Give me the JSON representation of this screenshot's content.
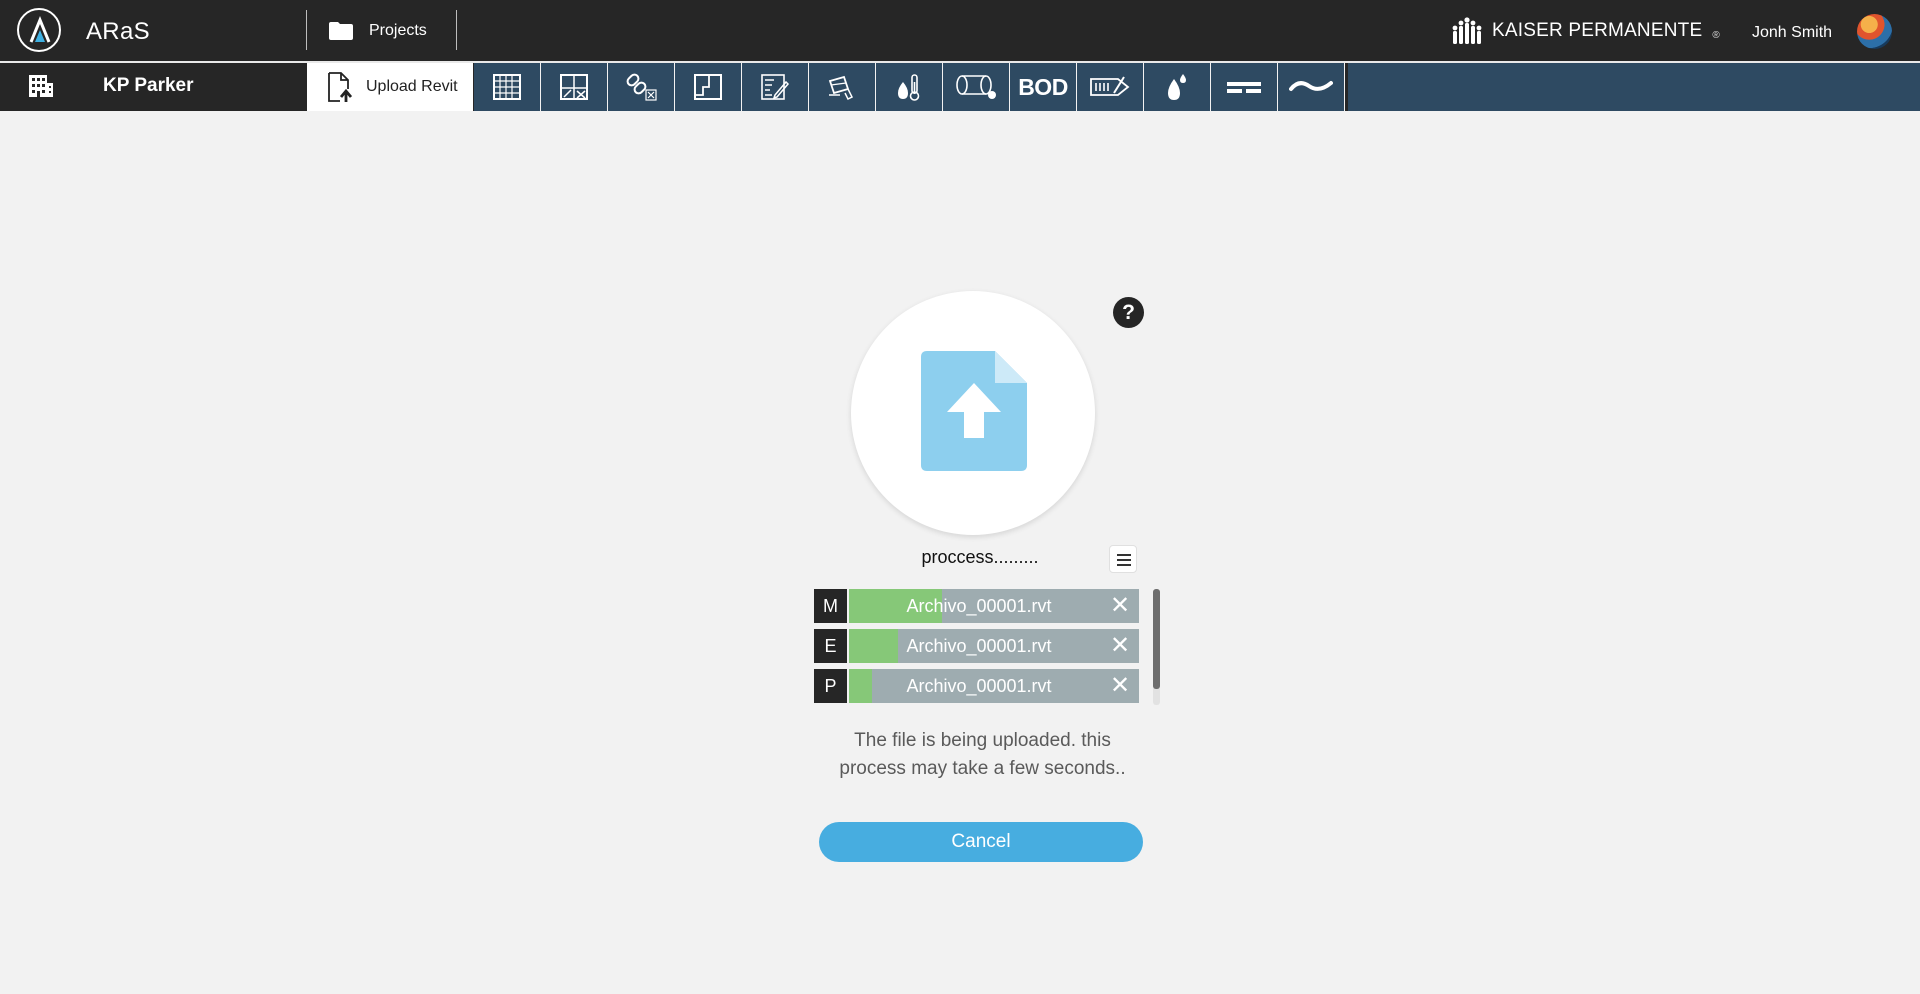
{
  "header": {
    "app_name": "ARaS",
    "projects_label": "Projects",
    "brand": "KAISER PERMANENTE",
    "brand_mark": "®",
    "user_name": "Jonh Smith"
  },
  "nav": {
    "project_name": "KP Parker",
    "active_tab": "Upload Revit",
    "tools": [
      {
        "icon": "grid-table-icon"
      },
      {
        "icon": "room-chart-icon"
      },
      {
        "icon": "link-excel-icon"
      },
      {
        "icon": "floor-plan-icon"
      },
      {
        "icon": "edit-sheet-icon"
      },
      {
        "icon": "paint-bucket-icon"
      },
      {
        "icon": "fire-temperature-icon"
      },
      {
        "icon": "duct-pipe-icon"
      },
      {
        "icon": "bod-text-icon",
        "label": "BOD"
      },
      {
        "icon": "equipment-tag-icon"
      },
      {
        "icon": "water-drop-icon"
      },
      {
        "icon": "dashed-lines-icon"
      },
      {
        "icon": "wave-icon"
      }
    ]
  },
  "upload": {
    "status": "proccess.........",
    "help": "?",
    "files": [
      {
        "letter": "M",
        "name": "Archivo_00001.rvt",
        "progress": 0.32
      },
      {
        "letter": "E",
        "name": "Archivo_00001.rvt",
        "progress": 0.17
      },
      {
        "letter": "P",
        "name": "Archivo_00001.rvt",
        "progress": 0.08
      }
    ],
    "message": "The file is being uploaded. this process may take a few seconds..",
    "cancel_label": "Cancel"
  },
  "colors": {
    "topbar": "#262626",
    "toolbar": "#2e4a62",
    "progress": "#86c878",
    "bar_bg": "#9eacb0",
    "accent": "#47ade0",
    "upload_icon": "#8dcfee"
  }
}
